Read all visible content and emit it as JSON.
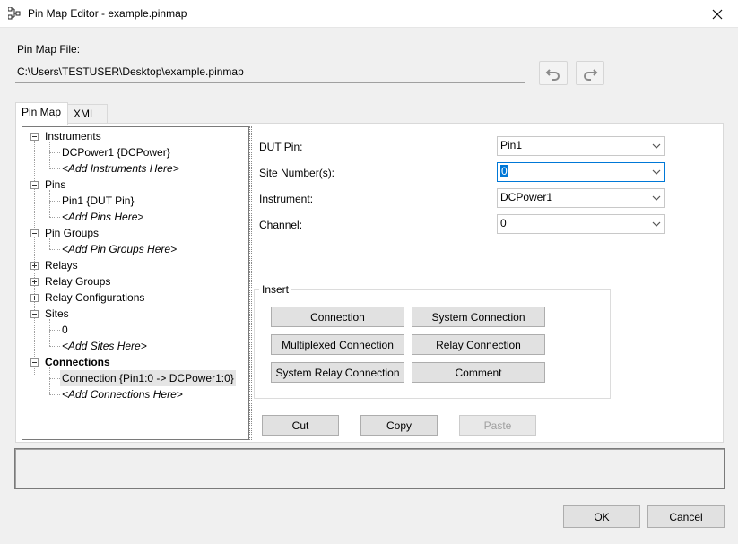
{
  "window": {
    "title": "Pin Map Editor - example.pinmap",
    "close_glyph": "✕"
  },
  "file": {
    "label": "Pin Map File:",
    "path": "C:\\Users\\TESTUSER\\Desktop\\example.pinmap"
  },
  "tabs": [
    {
      "label": "Pin Map"
    },
    {
      "label": "XML"
    }
  ],
  "tree": {
    "instruments": {
      "label": "Instruments",
      "items": [
        "DCPower1 {DCPower}"
      ],
      "add": "<Add Instruments Here>"
    },
    "pins": {
      "label": "Pins",
      "items": [
        "Pin1 {DUT Pin}"
      ],
      "add": "<Add Pins Here>"
    },
    "pin_groups": {
      "label": "Pin Groups",
      "add": "<Add Pin Groups Here>"
    },
    "relays": {
      "label": "Relays"
    },
    "relay_groups": {
      "label": "Relay Groups"
    },
    "relay_configurations": {
      "label": "Relay Configurations"
    },
    "sites": {
      "label": "Sites",
      "items": [
        "0"
      ],
      "add": "<Add Sites Here>"
    },
    "connections": {
      "label": "Connections",
      "items": [
        "Connection {Pin1:0 -> DCPower1:0}"
      ],
      "add": "<Add Connections Here>"
    }
  },
  "properties": {
    "dut_pin": {
      "label": "DUT Pin:",
      "value": "Pin1"
    },
    "site_numbers": {
      "label": "Site Number(s):",
      "value": "0"
    },
    "instrument": {
      "label": "Instrument:",
      "value": "DCPower1"
    },
    "channel": {
      "label": "Channel:",
      "value": "0"
    }
  },
  "insert": {
    "title": "Insert",
    "connection": "Connection",
    "system_connection": "System Connection",
    "multiplexed_connection": "Multiplexed Connection",
    "relay_connection": "Relay Connection",
    "system_relay_connection": "System Relay Connection",
    "comment": "Comment"
  },
  "edit": {
    "cut": "Cut",
    "copy": "Copy",
    "paste": "Paste"
  },
  "dialog": {
    "ok": "OK",
    "cancel": "Cancel"
  },
  "colors": {
    "accent": "#0078d7",
    "selection_bg": "#e5e5e5"
  }
}
